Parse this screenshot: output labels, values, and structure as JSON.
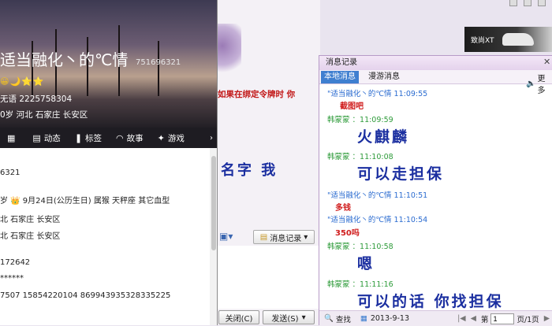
{
  "profile": {
    "nickname": "适当融化丶的℃情",
    "qq_number": "751696321",
    "badges": "😀🌙⭐⭐",
    "line1": "无语   2225758304",
    "line2": "0岁    河北  石家庄  长安区",
    "tabs": [
      {
        "icon": "grid-icon",
        "glyph": "▦",
        "label": ""
      },
      {
        "icon": "feed-icon",
        "glyph": "▤",
        "label": "动态"
      },
      {
        "icon": "bookmark-icon",
        "glyph": "❚",
        "label": "标签"
      },
      {
        "icon": "story-icon",
        "glyph": "◠",
        "label": "故事"
      },
      {
        "icon": "game-icon",
        "glyph": "✦",
        "label": "游戏"
      }
    ],
    "rows": [
      "6321",
      "岁   👑 9月24日(公历生日)    属猴    天秤座    其它血型",
      "北  石家庄  长安区",
      "北  石家庄  长安区",
      "172642",
      "******",
      "7507  15854220104  869943935328335225"
    ]
  },
  "chat": {
    "red_message": "如果在绑定令牌时  你",
    "blue_message": "名字  我",
    "history_button": "消息记录",
    "close_button": "关闭(C)",
    "send_button": "发送(S)"
  },
  "ad": {
    "text": "致尚XT"
  },
  "history": {
    "title": "消息记录",
    "tab_local": "本地消息",
    "tab_roam": "漫游消息",
    "more": "更多",
    "messages": [
      {
        "sender": "\"适当融化丶的℃情 11:09:55",
        "type": "self",
        "text": "截图吧",
        "style": "red"
      },
      {
        "sender": "韩蒙蒙      ：11:09:59",
        "type": "other",
        "text": "火麒麟",
        "style": "big"
      },
      {
        "sender": "韩蒙蒙      ：11:10:08",
        "type": "other",
        "text": "可以走担保",
        "style": "big"
      },
      {
        "sender": "\"适当融化丶的℃情 11:10:51",
        "type": "self",
        "text": "多钱",
        "style": "red"
      },
      {
        "sender": "\"适当融化丶的℃情 11:10:54",
        "type": "self",
        "text": "350吗",
        "style": "red"
      },
      {
        "sender": "韩蒙蒙      ：11:10:58",
        "type": "other",
        "text": "嗯",
        "style": "big"
      },
      {
        "sender": "韩蒙蒙      ：11:11:16",
        "type": "other",
        "text": "可以的话  你找担保",
        "style": "big"
      }
    ],
    "bottom": {
      "search": "查找",
      "date": "2013-9-13",
      "page_prefix": "第",
      "page_value": "1",
      "page_suffix": "页/1页"
    }
  },
  "colors": {
    "accent": "#3f7fd0",
    "self_name": "#2a6bd0",
    "other_name": "#2e9b3a",
    "red_text": "#d01c1c",
    "big_text": "#1b2fa0"
  }
}
